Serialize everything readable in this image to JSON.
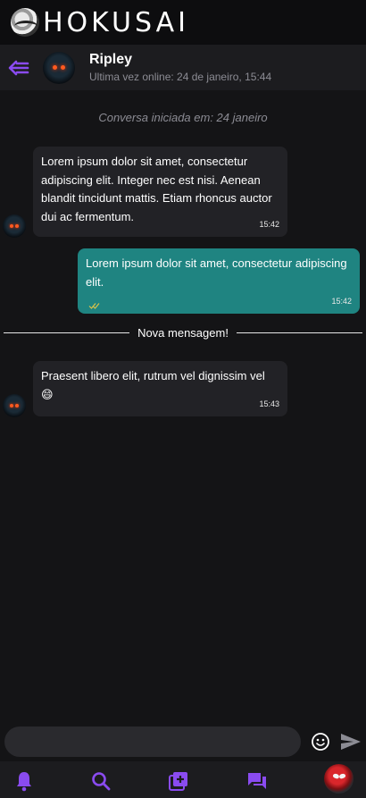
{
  "app": {
    "brand": "HOKUSAI"
  },
  "header": {
    "contact_name": "Ripley",
    "last_seen": "Ultima vez online: 24 de janeiro, 15:44"
  },
  "conversation": {
    "started": "Conversa iniciada em: 24 janeiro",
    "messages": [
      {
        "direction": "in",
        "text": "Lorem ipsum dolor sit amet, consectetur adipiscing elit. Integer nec est nisi. Aenean blandit tincidunt mattis. Etiam rhoncus auctor dui ac fermentum.",
        "time": "15:42"
      },
      {
        "direction": "out",
        "text": "Lorem ipsum dolor sit amet, consectetur adipiscing elit.",
        "time": "15:42"
      },
      {
        "direction": "in",
        "text": "Praesent libero elit, rutrum vel dignissim vel 😄",
        "time": "15:43"
      }
    ],
    "new_message_divider": "Nova mensagem!"
  },
  "composer": {
    "placeholder": "",
    "value": ""
  },
  "nav": {
    "items": [
      "notifications-icon",
      "search-icon",
      "add-post-icon",
      "chat-icon",
      "profile-avatar"
    ]
  },
  "colors": {
    "accent": "#8a4bf0",
    "outgoing_bubble": "#1f8481",
    "incoming_bubble": "#222226",
    "background": "#141416"
  }
}
